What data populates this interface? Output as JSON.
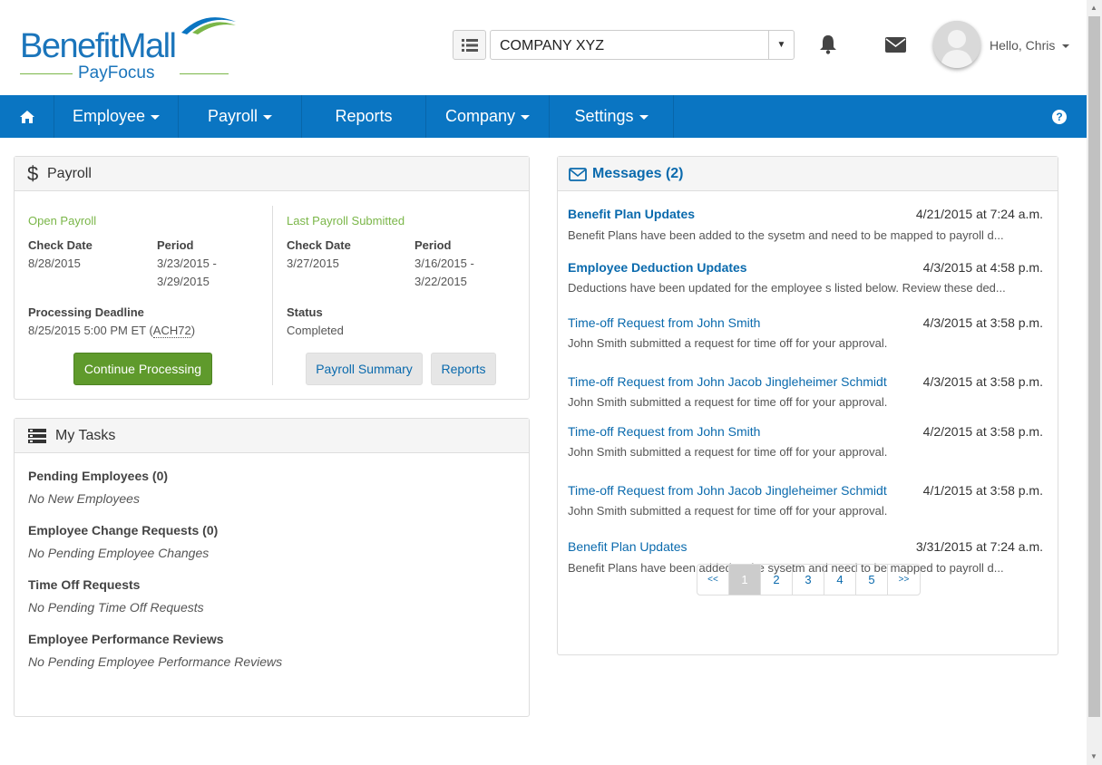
{
  "brand": {
    "name_a": "Benefit",
    "name_b": "Mall",
    "sub": "PayFocus"
  },
  "header": {
    "company": "COMPANY XYZ",
    "greeting": "Hello, Chris"
  },
  "nav": {
    "items": [
      {
        "label": "Employee"
      },
      {
        "label": "Payroll"
      },
      {
        "label": "Reports"
      },
      {
        "label": "Company"
      },
      {
        "label": "Settings"
      }
    ],
    "help": "?"
  },
  "payroll": {
    "title": "Payroll",
    "icon": "$",
    "open": {
      "heading": "Open Payroll",
      "check_date_label": "Check Date",
      "check_date": "8/28/2015",
      "period_label": "Period",
      "period_line1": "3/23/2015 -",
      "period_line2": "3/29/2015",
      "deadline_label": "Processing Deadline",
      "deadline_prefix": "8/25/2015 5:00 PM ET (",
      "deadline_code": "ACH72",
      "deadline_suffix": ")",
      "button": "Continue Processing"
    },
    "last": {
      "heading": "Last Payroll Submitted",
      "check_date_label": "Check Date",
      "check_date": "3/27/2015",
      "period_label": "Period",
      "period_line1": "3/16/2015 -",
      "period_line2": "3/22/2015",
      "status_label": "Status",
      "status": "Completed",
      "summary_button": "Payroll Summary",
      "reports_button": "Reports"
    }
  },
  "tasks": {
    "title": "My Tasks",
    "items": [
      {
        "label": "Pending Employees (0)",
        "note": "No New Employees"
      },
      {
        "label": "Employee Change Requests (0)",
        "note": "No Pending Employee Changes"
      },
      {
        "label": "Time Off Requests",
        "note": "No Pending Time Off Requests"
      },
      {
        "label": "Employee Performance Reviews",
        "note": "No Pending Employee Performance Reviews"
      }
    ]
  },
  "messages": {
    "title": "Messages (2)",
    "items": [
      {
        "title": "Benefit Plan Updates",
        "date": "4/21/2015 at 7:24 a.m.",
        "body": "Benefit Plans have been added to the sysetm and need to be mapped to payroll d..."
      },
      {
        "title": "Employee Deduction Updates",
        "date": "4/3/2015 at 4:58 p.m.",
        "body": "Deductions have been updated for the  employee s listed below. Review these ded..."
      },
      {
        "title": "Time-off Request from John Smith",
        "date": "4/3/2015 at 3:58 p.m.",
        "body": "John Smith submitted a request for time off for your approval."
      },
      {
        "title": "Time-off Request from John Jacob Jingleheimer Schmidt",
        "date": "4/3/2015 at 3:58 p.m.",
        "body": "John Smith submitted a request for time off for your approval."
      },
      {
        "title": "Time-off Request from John Smith",
        "date": "4/2/2015 at 3:58 p.m.",
        "body": "John Smith submitted a request for time off for your approval."
      },
      {
        "title": "Time-off Request from John Jacob Jingleheimer Schmidt",
        "date": "4/1/2015 at 3:58 p.m.",
        "body": "John Smith submitted a request for time off for your approval."
      },
      {
        "title": "Benefit Plan Updates",
        "date": "3/31/2015 at 7:24 a.m.",
        "body": "Benefit Plans have been added to the sysetm and need to be mapped to payroll d..."
      }
    ],
    "pager": [
      "<<",
      "1",
      "2",
      "3",
      "4",
      "5",
      ">>"
    ]
  },
  "colors": {
    "nav_blue": "#0a75c2",
    "brand_green": "#7ab648",
    "action_green": "#5f9a2c",
    "link_blue": "#0a6aad"
  }
}
